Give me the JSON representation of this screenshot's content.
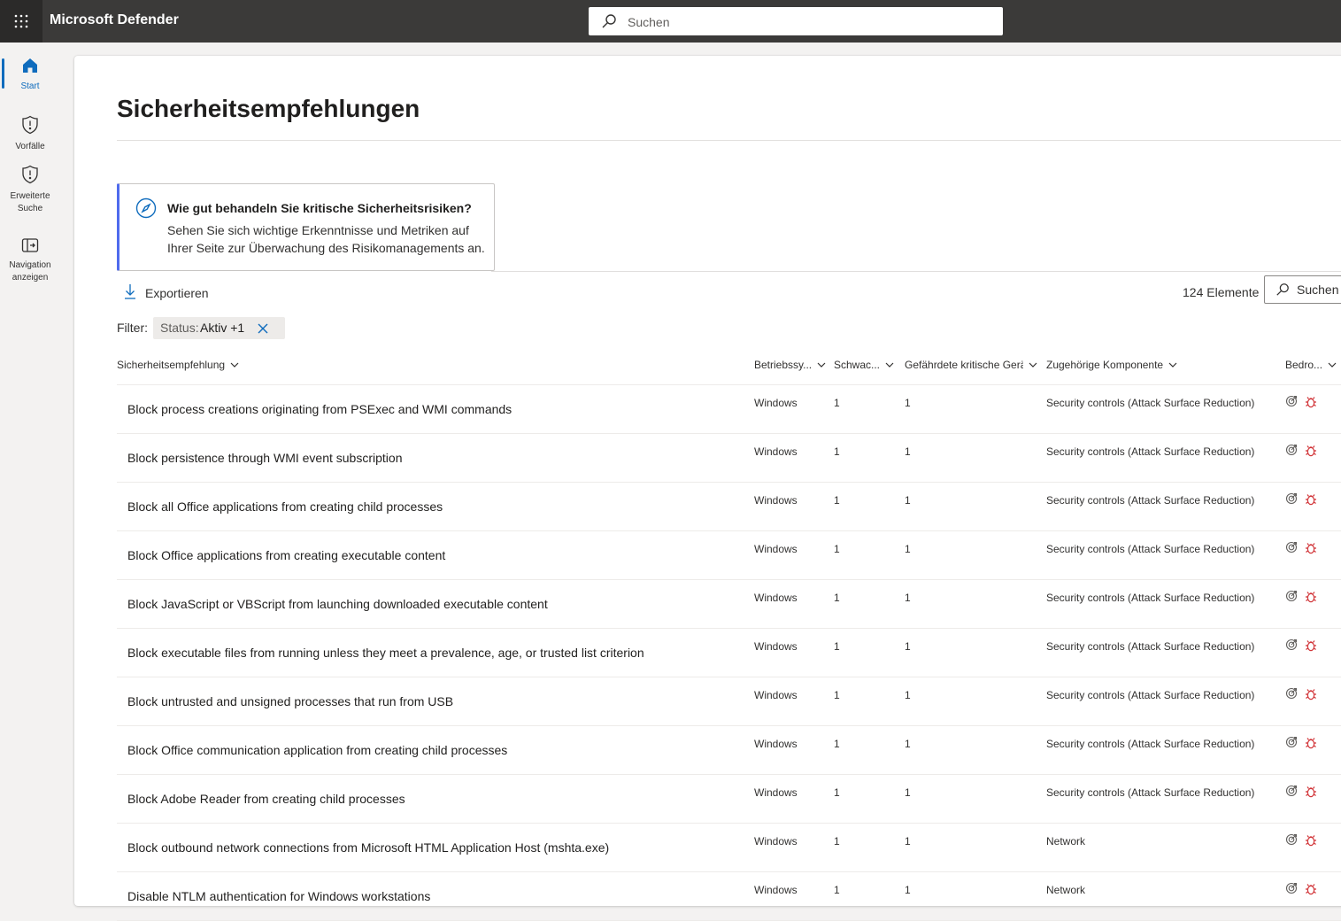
{
  "app": {
    "title": "Microsoft Defender"
  },
  "topbar": {
    "search_placeholder": "Suchen",
    "waffle_icon": "waffle-icon",
    "search_icon": "search-icon"
  },
  "nav": {
    "items": [
      {
        "label": "Start",
        "icon": "home-icon",
        "active": true
      },
      {
        "label": "Vorfälle",
        "icon": "shield-alert-icon"
      },
      {
        "label": "Erweiterte Suche",
        "icon": "shield-alert-icon"
      },
      {
        "label": "Navigation anzeigen",
        "icon": "expand-nav-icon"
      }
    ]
  },
  "page": {
    "title": "Sicherheitsempfehlungen"
  },
  "insight": {
    "heading": "Wie gut behandeln Sie kritische Sicherheitsrisiken?",
    "body": "Sehen Sie sich wichtige Erkenntnisse und Metriken auf Ihrer Seite zur Überwachung des Risikomanagements an.",
    "icon": "compass-icon"
  },
  "toolbar": {
    "export_label": "Exportieren",
    "count_label": "124 Elemente",
    "search_label": "Suchen"
  },
  "filter": {
    "label": "Filter:",
    "chip_key": "Status:",
    "chip_value": "Aktiv +1"
  },
  "table": {
    "columns": [
      "Sicherheitsempfehlung",
      "Betriebssy...",
      "Schwac...",
      "Gefährdete kritische Gerät",
      "Zugehörige Komponente",
      "Bedro..."
    ],
    "rows": [
      {
        "name": "Block process creations originating from PSExec and WMI commands",
        "os": "Windows",
        "vulnerabilities": "1",
        "devices": "1",
        "component": "Security controls (Attack Surface Reduction)"
      },
      {
        "name": "Block persistence through WMI event subscription",
        "os": "Windows",
        "vulnerabilities": "1",
        "devices": "1",
        "component": "Security controls (Attack Surface Reduction)"
      },
      {
        "name": "Block all Office applications from creating child processes",
        "os": "Windows",
        "vulnerabilities": "1",
        "devices": "1",
        "component": "Security controls (Attack Surface Reduction)"
      },
      {
        "name": "Block Office applications from creating executable content",
        "os": "Windows",
        "vulnerabilities": "1",
        "devices": "1",
        "component": "Security controls (Attack Surface Reduction)"
      },
      {
        "name": "Block JavaScript or VBScript from launching downloaded executable content",
        "os": "Windows",
        "vulnerabilities": "1",
        "devices": "1",
        "component": "Security controls (Attack Surface Reduction)"
      },
      {
        "name": "Block executable files from running unless they meet a prevalence, age, or trusted list criterion",
        "os": "Windows",
        "vulnerabilities": "1",
        "devices": "1",
        "component": "Security controls (Attack Surface Reduction)"
      },
      {
        "name": "Block untrusted and unsigned processes that run from USB",
        "os": "Windows",
        "vulnerabilities": "1",
        "devices": "1",
        "component": "Security controls (Attack Surface Reduction)"
      },
      {
        "name": "Block Office communication application from creating child processes",
        "os": "Windows",
        "vulnerabilities": "1",
        "devices": "1",
        "component": "Security controls (Attack Surface Reduction)"
      },
      {
        "name": "Block Adobe Reader from creating child processes",
        "os": "Windows",
        "vulnerabilities": "1",
        "devices": "1",
        "component": "Security controls (Attack Surface Reduction)"
      },
      {
        "name": "Block outbound network connections from Microsoft HTML Application Host (mshta.exe)",
        "os": "Windows",
        "vulnerabilities": "1",
        "devices": "1",
        "component": "Network"
      },
      {
        "name": "Disable NTLM authentication for Windows workstations",
        "os": "Windows",
        "vulnerabilities": "1",
        "devices": "1",
        "component": "Network"
      }
    ],
    "threat_icons": [
      "threat-target-icon",
      "bug-icon"
    ],
    "colors": {
      "bug": "#d13438",
      "accent": "#0f6cbd",
      "insight_bar": "#4f6bed"
    }
  }
}
